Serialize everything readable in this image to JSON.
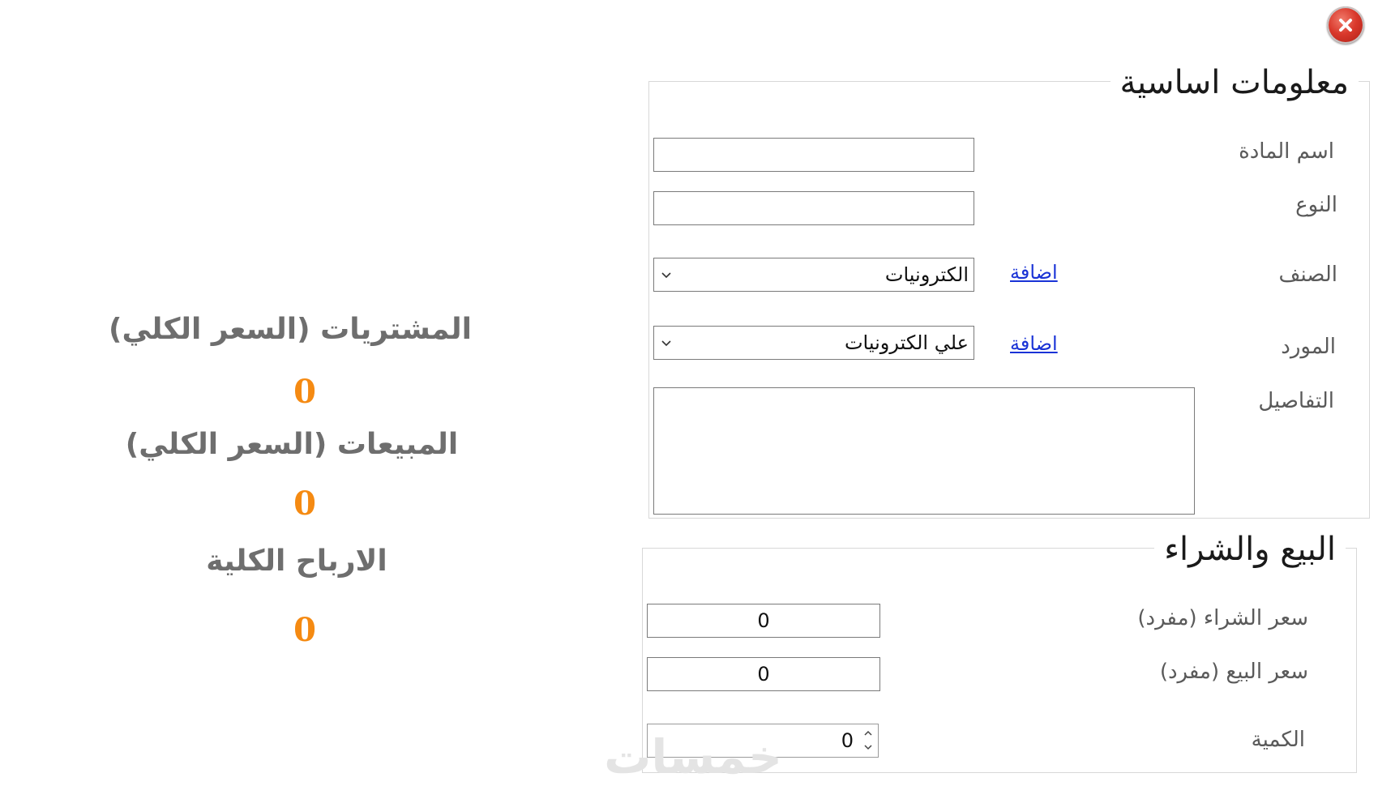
{
  "window": {
    "close_icon": "close-icon"
  },
  "basic_info": {
    "title": "معلومات اساسية",
    "item_name_label": "اسم المادة",
    "item_name_value": "",
    "type_label": "النوع",
    "type_value": "",
    "category_label": "الصنف",
    "category_value": "الكترونيات",
    "category_add_link": "اضافة",
    "supplier_label": "المورد",
    "supplier_value": "علي الكترونيات",
    "supplier_add_link": "اضافة",
    "details_label": "التفاصيل",
    "details_value": ""
  },
  "buy_sell": {
    "title": "البيع والشراء",
    "purchase_price_label": "سعر الشراء (مفرد)",
    "purchase_price_value": "0",
    "sale_price_label": "سعر البيع (مفرد)",
    "sale_price_value": "0",
    "quantity_label": "الكمية",
    "quantity_value": "0"
  },
  "stats": {
    "purchases_label": "المشتريات (السعر الكلي)",
    "purchases_value": "0",
    "sales_label": "المبيعات (السعر الكلي)",
    "sales_value": "0",
    "profits_label": "الارباح الكلية",
    "profits_value": "0"
  },
  "watermark": "خمسات",
  "colors": {
    "stat_value": "#f58a12",
    "stat_label": "#6e6e6e",
    "link": "#1a33d6",
    "close_button": "#d9382b"
  }
}
